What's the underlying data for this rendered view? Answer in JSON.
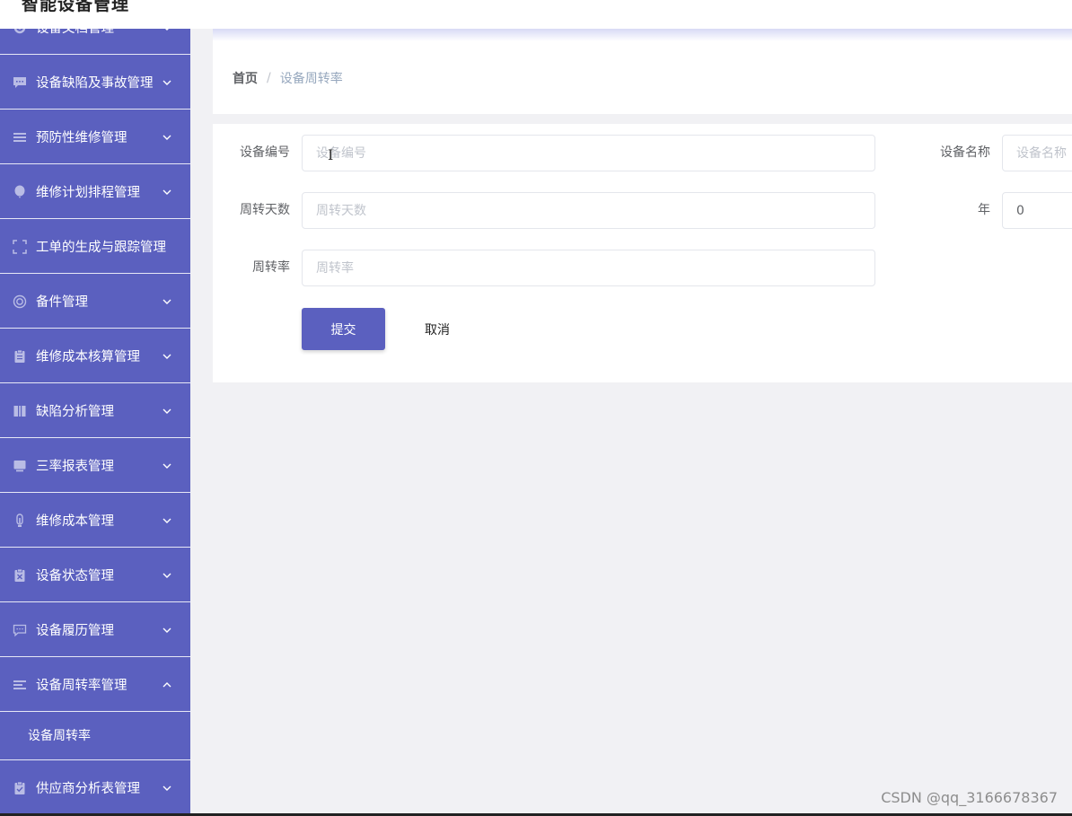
{
  "app": {
    "title": "智能设备管理"
  },
  "colors": {
    "sidebar_bg": "#5b60bf",
    "primary": "#5b60bf",
    "menu_icon": "#b9bce5"
  },
  "sidebar": {
    "items": [
      {
        "label": "设备文档管理",
        "icon": "settings-icon",
        "expanded": false
      },
      {
        "label": "设备缺陷及事故管理",
        "icon": "chat-bubble-icon",
        "expanded": false
      },
      {
        "label": "预防性维修管理",
        "icon": "list-icon",
        "expanded": false
      },
      {
        "label": "维修计划排程管理",
        "icon": "balloon-icon",
        "expanded": false
      },
      {
        "label": "工单的生成与跟踪管理",
        "icon": "fullscreen-icon",
        "expanded": false
      },
      {
        "label": "备件管理",
        "icon": "lifebuoy-icon",
        "expanded": false
      },
      {
        "label": "维修成本核算管理",
        "icon": "clipboard-icon",
        "expanded": false
      },
      {
        "label": "缺陷分析管理",
        "icon": "notebook-icon",
        "expanded": false
      },
      {
        "label": "三率报表管理",
        "icon": "monitor-icon",
        "expanded": false
      },
      {
        "label": "维修成本管理",
        "icon": "thermometer-icon",
        "expanded": false
      },
      {
        "label": "设备状态管理",
        "icon": "clipboard-x-icon",
        "expanded": false
      },
      {
        "label": "设备履历管理",
        "icon": "message-icon",
        "expanded": false
      },
      {
        "label": "设备周转率管理",
        "icon": "list-icon",
        "expanded": true,
        "children": [
          "设备周转率"
        ]
      },
      {
        "label": "供应商分析表管理",
        "icon": "clipboard-check-icon",
        "expanded": false
      }
    ]
  },
  "breadcrumb": {
    "home": "首页",
    "separator": "/",
    "current": "设备周转率"
  },
  "form": {
    "device_code": {
      "label": "设备编号",
      "placeholder": "设备编号",
      "value": ""
    },
    "device_name": {
      "label": "设备名称",
      "placeholder": "设备名称",
      "value": ""
    },
    "turnover_days": {
      "label": "周转天数",
      "placeholder": "周转天数",
      "value": ""
    },
    "year": {
      "label": "年",
      "placeholder": "",
      "value": "0"
    },
    "turnover_rate": {
      "label": "周转率",
      "placeholder": "周转率",
      "value": ""
    },
    "submit_label": "提交",
    "cancel_label": "取消"
  },
  "watermark": "CSDN @qq_3166678367"
}
